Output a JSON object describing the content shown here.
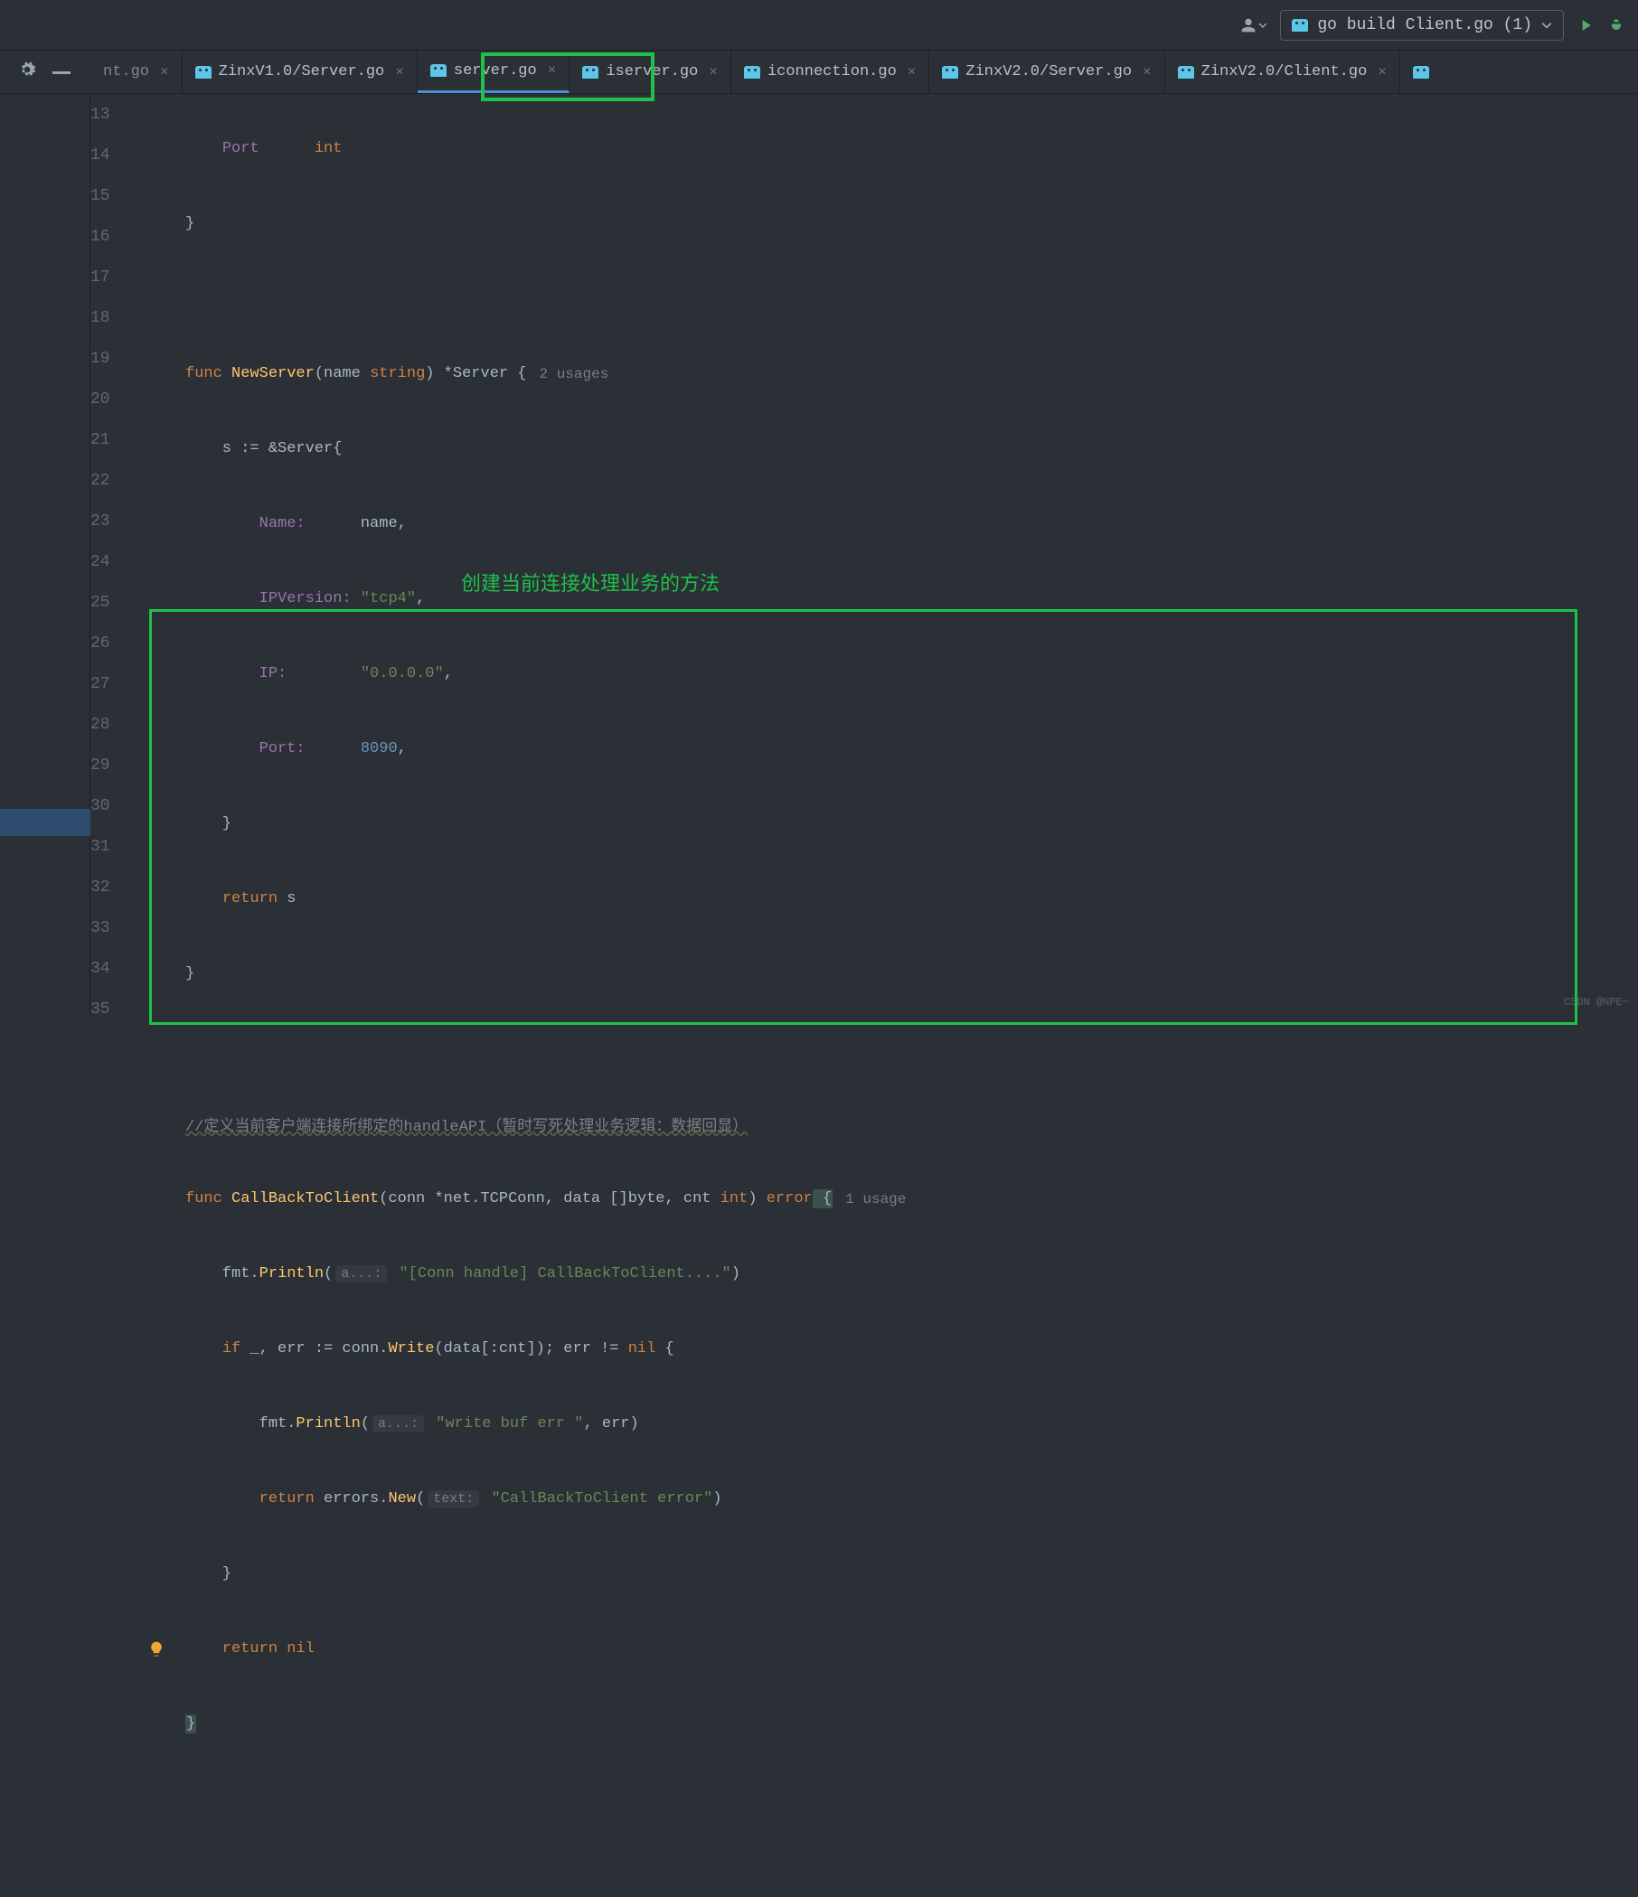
{
  "toolbar": {
    "run_config_label": "go build Client.go (1)"
  },
  "tabs": [
    {
      "label": "nt.go",
      "partial": true
    },
    {
      "label": "ZinxV1.0/Server.go"
    },
    {
      "label": "server.go",
      "active": true
    },
    {
      "label": "iserver.go"
    },
    {
      "label": "iconnection.go"
    },
    {
      "label": "ZinxV2.0/Server.go"
    },
    {
      "label": "ZinxV2.0/Client.go"
    }
  ],
  "annotation_text": "创建当前连接处理业务的方法",
  "line_numbers": [
    "13",
    "14",
    "15",
    "16",
    "17",
    "18",
    "19",
    "20",
    "21",
    "22",
    "23",
    "24",
    "25",
    "26",
    "27",
    "28",
    "29",
    "30",
    "31",
    "32",
    "33",
    "34",
    "35"
  ],
  "code": {
    "l13": {
      "field": "Port",
      "type": "int"
    },
    "l14": {
      "brace": "}"
    },
    "l16": {
      "kw": "func",
      "name": "NewServer",
      "params_open": "(name ",
      "ptype": "string",
      "params_close": ") *Server {",
      "usage": "2 usages"
    },
    "l17": {
      "text1": "    s := &",
      "text2": "Server{"
    },
    "l18": {
      "field": "Name:",
      "val_ident": "name",
      "comma": ","
    },
    "l19": {
      "field": "IPVersion:",
      "val_str": "\"tcp4\"",
      "comma": ","
    },
    "l20": {
      "field": "IP:",
      "val_str": "\"0.0.0.0\"",
      "comma": ","
    },
    "l21": {
      "field": "Port:",
      "val_num": "8090",
      "comma": ","
    },
    "l22": {
      "brace": "    }"
    },
    "l23": {
      "kw": "return",
      "ident": " s"
    },
    "l24": {
      "brace": "}"
    },
    "l26": {
      "comment": "//定义当前客户端连接所绑定的handleAPI（暂时写死处理业务逻辑：数据回显）"
    },
    "l27": {
      "kw": "func",
      "name": "CallBackToClient",
      "params": "(conn *net.TCPConn, data []byte, cnt ",
      "ptype": "int",
      "close": ") ",
      "ret": "error",
      "brace": " {",
      "usage": "1 usage"
    },
    "l28": {
      "obj": "    fmt.",
      "fn": "Println",
      "open": "(",
      "hint": "a...:",
      "str": " \"[Conn handle] CallBackToClient....\"",
      "close": ")"
    },
    "l29": {
      "kw": "if",
      "mid": " _, err := conn.",
      "fn": "Write",
      "args": "(data[:cnt]); err != ",
      "nil": "nil",
      "brace": " {"
    },
    "l30": {
      "obj": "        fmt.",
      "fn": "Println",
      "open": "(",
      "hint": "a...:",
      "str": " \"write buf err \"",
      "rest": ", err)"
    },
    "l31": {
      "kw": "        return",
      "obj": " errors.",
      "fn": "New",
      "open": "(",
      "hint": "text:",
      "str": " \"CallBackToClient error\"",
      "close": ")"
    },
    "l32": {
      "brace": "    }"
    },
    "l33": {
      "kw": "    return ",
      "nil": "nil"
    },
    "l34": {
      "brace": "}"
    }
  },
  "watermark": "CSDN @NPE~"
}
